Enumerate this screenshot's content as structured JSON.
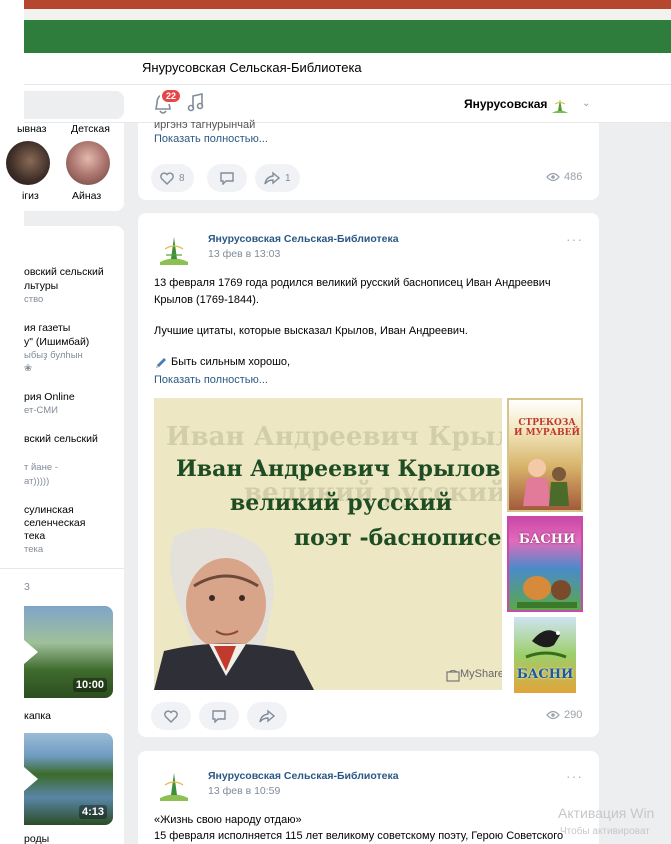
{
  "titlebar": {
    "title": "Янурусовская Сельская-Библиотека"
  },
  "header": {
    "notif_count": "22",
    "username": "Янурусовская"
  },
  "friends": {
    "top_names": [
      "ывназ",
      "Детская"
    ],
    "names": [
      "ігиз",
      "Айназ"
    ]
  },
  "groups": [
    {
      "line1": "овский сельский",
      "line2": "льтуры",
      "line3": "ство"
    },
    {
      "line1": "ия газеты",
      "line2": "у\" (Ишимбай)",
      "line3": "ыбыҙ булһын",
      "line4": "❀"
    },
    {
      "line1": "рия Online",
      "line2": "ет-СМИ"
    },
    {
      "line1": "вский сельский",
      "line2": "т йане -",
      "line3": "ат)))))"
    },
    {
      "line1": "сулинская",
      "line2": "селенческая",
      "line3": "тека",
      "line4": "тека"
    }
  ],
  "videos": {
    "section_count": "3",
    "items": [
      {
        "duration": "10:00",
        "caption": "капка"
      },
      {
        "duration": "4:13",
        "caption": "роды"
      }
    ]
  },
  "post0": {
    "cut_text": "иргэнэ тагнурынчай",
    "show_more": "Показать полностью...",
    "likes": "8",
    "shares": "1",
    "views": "486"
  },
  "post1": {
    "author": "Янурусовская Сельская-Библиотека",
    "date": "13 фев в 13:03",
    "p1": "13 февраля 1769 года родился великий русский баснописец Иван Андреевич",
    "p2": "Крылов (1769-1844).",
    "p3": "Лучшие цитаты, которые высказал Крылов, Иван Андреевич.",
    "p4": "Быть сильным хорошо,",
    "show_more": "Показать полностью...",
    "banner": {
      "ghost1": "Иван Андреевич Крылов",
      "ghost2": "великий русский",
      "line1": "Иван Андреевич Крылов -",
      "line2": "великий русский",
      "line3": "поэт -баснописец.",
      "brand": "MyShared"
    },
    "books": [
      "СТРЕКОЗА И МУРАВЕЙ",
      "БАСНИ",
      "БАСНИ"
    ],
    "views": "290"
  },
  "post2": {
    "author": "Янурусовская Сельская-Библиотека",
    "date": "13 фев в 10:59",
    "l1": "«Жизнь свою народу отдаю»",
    "l2": "15 февраля исполняется 115 лет великому советскому поэту, Герою Советского"
  },
  "os_watermark": {
    "line1": "Активация Win",
    "line2": "Чтобы активироват"
  },
  "colors": {
    "brand_green": "#2e7d3c",
    "link": "#2a5885",
    "badge": "#e64646"
  }
}
